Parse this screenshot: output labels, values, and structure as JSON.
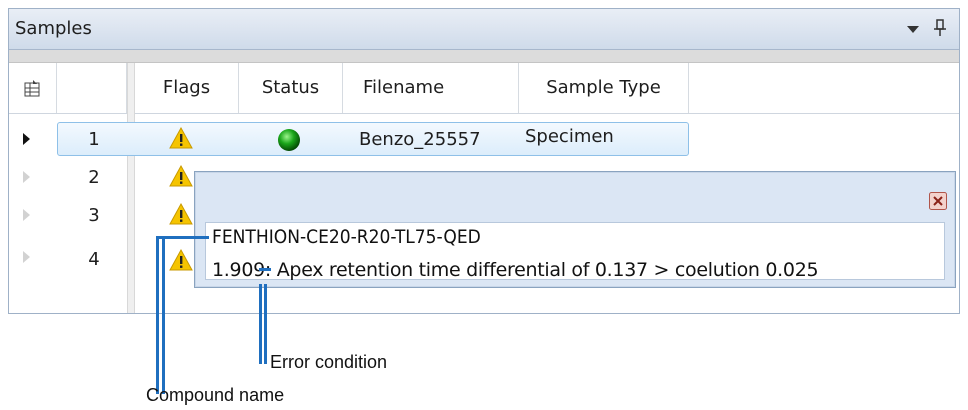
{
  "panel": {
    "title": "Samples",
    "columns": {
      "flags": "Flags",
      "status": "Status",
      "filename": "Filename",
      "sample_type": "Sample Type"
    },
    "rows": [
      {
        "num": "1",
        "filename": "Benzo_25557",
        "sample_type": "Specimen",
        "status": "green-ball-icon"
      },
      {
        "num": "2"
      },
      {
        "num": "3"
      },
      {
        "num": "4"
      }
    ]
  },
  "tooltip": {
    "compound": "FENTHION-CE20-R20-TL75-QED",
    "error": "1.909: Apex retention time differential of 0.137 > coelution 0.025"
  },
  "callouts": {
    "error_condition": "Error condition",
    "compound_name": "Compound name"
  },
  "colors": {
    "callout": "#1f6fbf",
    "selection": "#dcedfb",
    "warning": "#f5c400"
  }
}
